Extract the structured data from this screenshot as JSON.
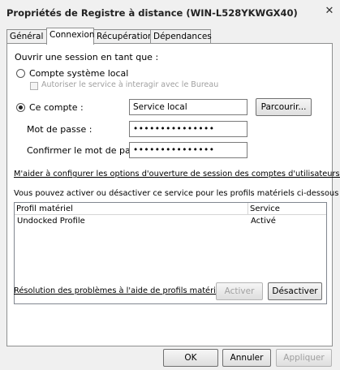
{
  "window": {
    "title": "Propriétés de Registre à distance (WIN-L528YKWGX40)",
    "close": "✕"
  },
  "tabs": [
    {
      "label": "Général"
    },
    {
      "label": "Connexion"
    },
    {
      "label": "Récupération"
    },
    {
      "label": "Dépendances"
    }
  ],
  "logon": {
    "section_label": "Ouvrir une session en tant que :",
    "local_system_label": "Compte système local",
    "allow_desktop_label": "Autoriser le service à interagir avec le Bureau",
    "this_account_label": "Ce compte :",
    "account_value": "Service local",
    "browse_label": "Parcourir...",
    "password_label": "Mot de passe :",
    "password_value": "•••••••••••••••",
    "confirm_label": "Confirmer le mot de passe :",
    "confirm_value": "•••••••••••••••",
    "help_link": "M'aider à configurer les options d'ouverture de session des comptes d'utilisateurs."
  },
  "hardware": {
    "description": "Vous pouvez activer ou désactiver ce service pour les profils matériels ci-dessous :",
    "columns": [
      "Profil matériel",
      "Service"
    ],
    "rows": [
      {
        "profile": "Undocked Profile",
        "service": "Activé"
      }
    ],
    "troubleshoot_link": "Résolution des problèmes à l'aide de profils matériels",
    "enable_label": "Activer",
    "disable_label": "Désactiver"
  },
  "footer": {
    "ok": "OK",
    "cancel": "Annuler",
    "apply": "Appliquer"
  }
}
